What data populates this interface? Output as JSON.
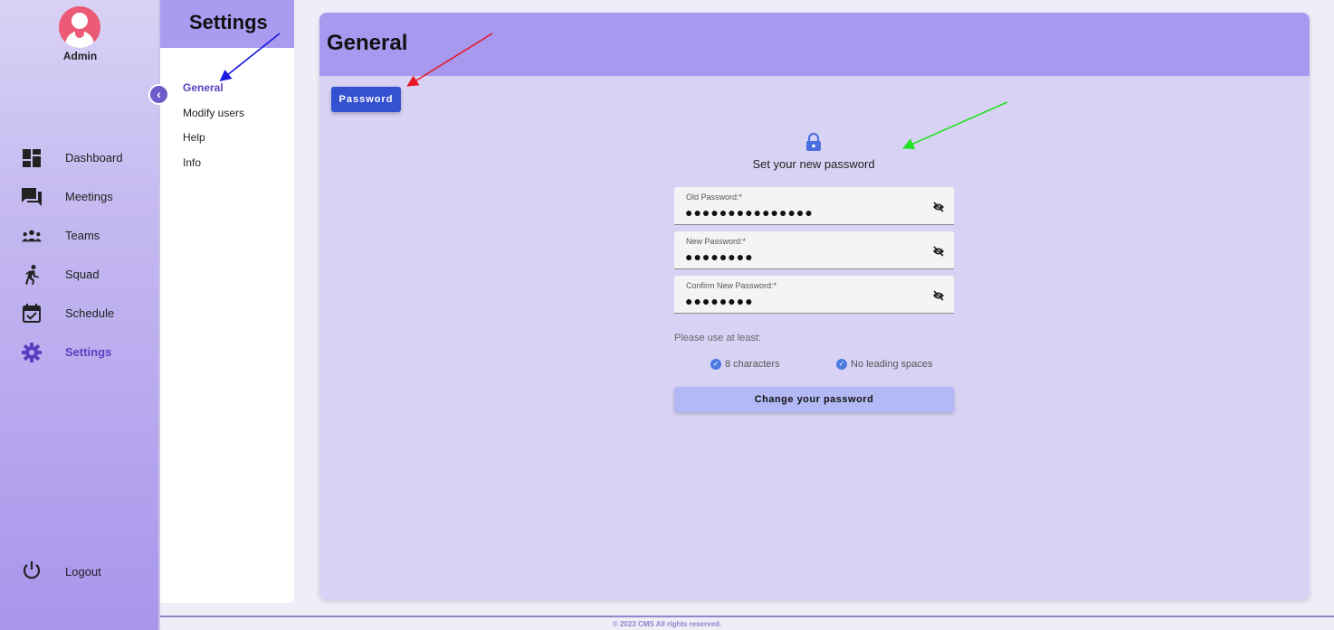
{
  "user": {
    "name": "Admin"
  },
  "sidebar": {
    "collapse_glyph": "‹",
    "items": [
      {
        "label": "Dashboard",
        "icon": "dashboard-icon"
      },
      {
        "label": "Meetings",
        "icon": "forum-icon"
      },
      {
        "label": "Teams",
        "icon": "groups-icon"
      },
      {
        "label": "Squad",
        "icon": "running-person-icon"
      },
      {
        "label": "Schedule",
        "icon": "calendar-check-icon"
      },
      {
        "label": "Settings",
        "icon": "gear-icon",
        "active": true
      }
    ],
    "logout_label": "Logout"
  },
  "settings_panel": {
    "title": "Settings",
    "links": [
      "General",
      "Modify users",
      "Help",
      "Info"
    ],
    "active_link": "General"
  },
  "main": {
    "title": "General",
    "tab_label": "Password",
    "form": {
      "title": "Set your new password",
      "old_password": {
        "label": "Old Password:*",
        "value": "●●●●●●●●●●●●●●●"
      },
      "new_password": {
        "label": "New Password:*",
        "value": "●●●●●●●●"
      },
      "confirm_password": {
        "label": "Confirm New Password:*",
        "value": "●●●●●●●●"
      },
      "hint": "Please use at least:",
      "requirements": [
        "8 characters",
        "No leading spaces"
      ],
      "submit_label": "Change your password"
    }
  },
  "footer": {
    "text": "© 2023 CMS All rights reserved."
  },
  "colors": {
    "accent": "#6e5bc9",
    "primary_button": "#3451d1",
    "header_purple": "#a699ef",
    "annotation_blue": "#1a1ae0",
    "annotation_red": "#e8182a",
    "annotation_green": "#22e022"
  }
}
